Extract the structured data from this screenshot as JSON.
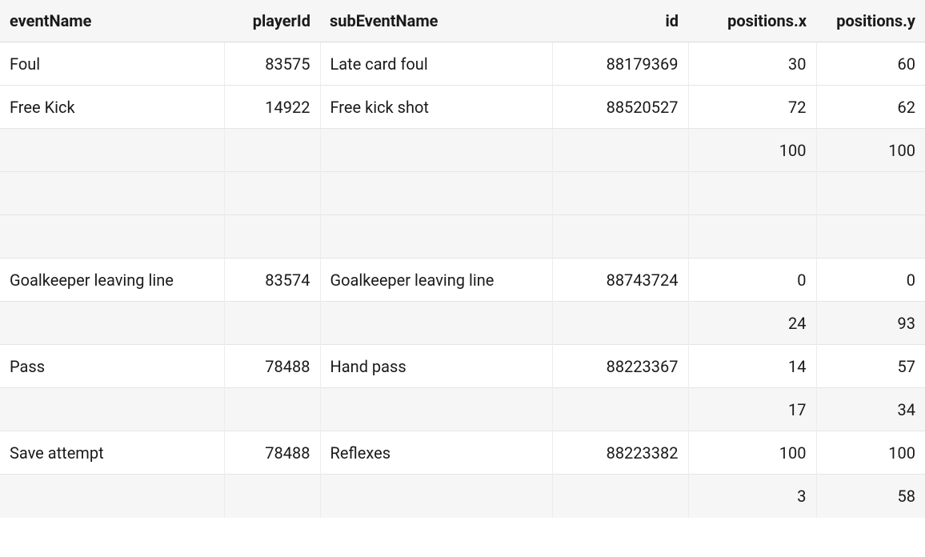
{
  "headers": {
    "eventName": "eventName",
    "playerId": "playerId",
    "subEventName": "subEventName",
    "id": "id",
    "posx": "positions.x",
    "posy": "positions.y"
  },
  "rows": [
    {
      "eventName": "Foul",
      "playerId": "83575",
      "subEventName": "Late card foul",
      "id": "88179369",
      "posx": "30",
      "posy": "60",
      "stripe": false
    },
    {
      "eventName": "Free Kick",
      "playerId": "14922",
      "subEventName": "Free kick shot",
      "id": "88520527",
      "posx": "72",
      "posy": "62",
      "stripe": false
    },
    {
      "eventName": "",
      "playerId": "",
      "subEventName": "",
      "id": "",
      "posx": "100",
      "posy": "100",
      "stripe": true
    },
    {
      "eventName": "",
      "playerId": "",
      "subEventName": "",
      "id": "",
      "posx": "",
      "posy": "",
      "stripe": true
    },
    {
      "eventName": "",
      "playerId": "",
      "subEventName": "",
      "id": "",
      "posx": "",
      "posy": "",
      "stripe": true
    },
    {
      "eventName": "Goalkeeper leaving line",
      "playerId": "83574",
      "subEventName": "Goalkeeper leaving line",
      "id": "88743724",
      "posx": "0",
      "posy": "0",
      "stripe": false
    },
    {
      "eventName": "",
      "playerId": "",
      "subEventName": "",
      "id": "",
      "posx": "24",
      "posy": "93",
      "stripe": true
    },
    {
      "eventName": "Pass",
      "playerId": "78488",
      "subEventName": "Hand pass",
      "id": "88223367",
      "posx": "14",
      "posy": "57",
      "stripe": false
    },
    {
      "eventName": "",
      "playerId": "",
      "subEventName": "",
      "id": "",
      "posx": "17",
      "posy": "34",
      "stripe": true
    },
    {
      "eventName": "Save attempt",
      "playerId": "78488",
      "subEventName": "Reflexes",
      "id": "88223382",
      "posx": "100",
      "posy": "100",
      "stripe": false
    },
    {
      "eventName": "",
      "playerId": "",
      "subEventName": "",
      "id": "",
      "posx": "3",
      "posy": "58",
      "stripe": true
    }
  ]
}
